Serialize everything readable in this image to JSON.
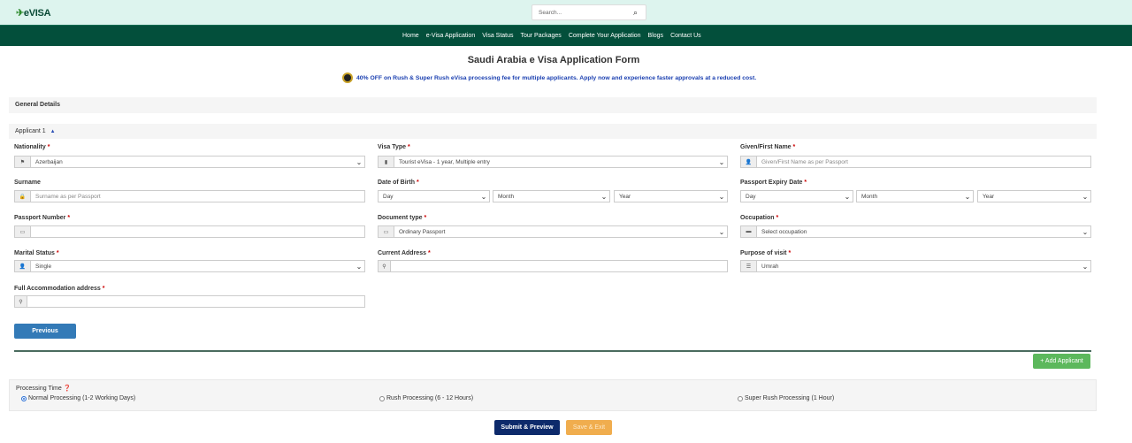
{
  "header": {
    "logo": "eVISA",
    "search_placeholder": "Search..."
  },
  "nav": [
    "Home",
    "e-Visa Application",
    "Visa Status",
    "Tour Packages",
    "Complete Your Application",
    "Blogs",
    "Contact Us"
  ],
  "page_title": "Saudi Arabia e Visa Application Form",
  "promo": "40% OFF on Rush & Super Rush eVisa processing fee for multiple applicants. Apply now and experience faster approvals at a reduced cost.",
  "sections": {
    "general": "General Details",
    "applicant": "Applicant 1"
  },
  "fields": {
    "nationality": {
      "label": "Nationality",
      "value": "Azerbaijan"
    },
    "visa_type": {
      "label": "Visa Type",
      "value": "Tourist eVisa - 1 year, Multiple entry"
    },
    "first_name": {
      "label": "Given/First Name",
      "placeholder": "Given/First Name as per Passport"
    },
    "surname": {
      "label": "Surname",
      "placeholder": "Surname as per Passport"
    },
    "dob": {
      "label": "Date of Birth",
      "day": "Day",
      "month": "Month",
      "year": "Year"
    },
    "expiry": {
      "label": "Passport Expiry Date",
      "day": "Day",
      "month": "Month",
      "year": "Year"
    },
    "passport_number": {
      "label": "Passport Number",
      "value": ""
    },
    "document_type": {
      "label": "Document type",
      "value": "Ordinary Passport"
    },
    "occupation": {
      "label": "Occupation",
      "value": "Select occupation"
    },
    "marital_status": {
      "label": "Marital Status",
      "value": "Single"
    },
    "current_address": {
      "label": "Current Address",
      "value": ""
    },
    "purpose": {
      "label": "Purpose of visit",
      "value": "Umrah"
    },
    "accommodation": {
      "label": "Full Accommodation address",
      "value": ""
    }
  },
  "buttons": {
    "previous": "Previous",
    "add_applicant": "+ Add Applicant",
    "submit": "Submit & Preview",
    "save": "Save & Exit"
  },
  "processing": {
    "label": "Processing Time",
    "options": [
      "Normal Processing (1-2 Working Days)",
      "Rush Processing (6 - 12 Hours)",
      "Super Rush Processing (1 Hour)"
    ],
    "selected": 0
  },
  "required_mark": "*"
}
